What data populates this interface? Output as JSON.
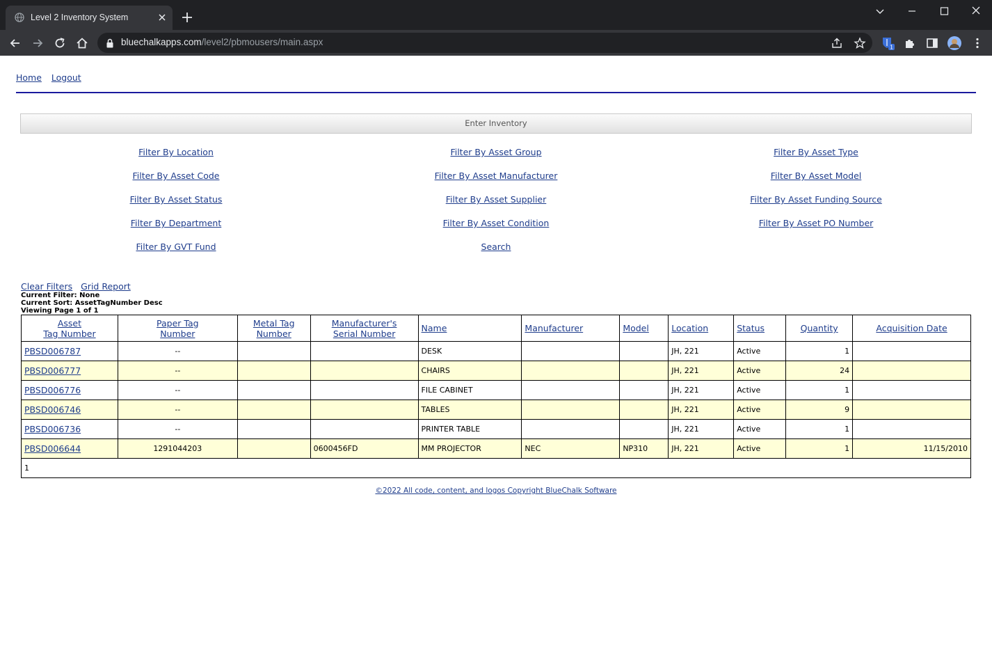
{
  "browser": {
    "tab_title": "Level 2 Inventory System",
    "url_host": "bluechalkapps.com",
    "url_path": "/level2/pbmousers/main.aspx",
    "extension_badge": "1"
  },
  "nav": {
    "home": "Home",
    "logout": "Logout"
  },
  "enter_inventory": "Enter Inventory",
  "filters": [
    [
      "Filter By Location",
      "Filter By Asset Group",
      "Filter By Asset Type"
    ],
    [
      "Filter By Asset Code",
      "Filter By Asset Manufacturer",
      "Filter By Asset Model"
    ],
    [
      "Filter By Asset Status",
      "Filter By Asset Supplier",
      "Filter By Asset Funding Source"
    ],
    [
      "Filter By Department",
      "Filter By Asset Condition",
      "Filter By Asset PO Number"
    ],
    [
      "Filter By GVT Fund",
      "Search",
      ""
    ]
  ],
  "grid_links": {
    "clear": "Clear Filters",
    "report": "Grid Report"
  },
  "status": {
    "filter": "Current Filter: None",
    "sort": "Current Sort: AssetTagNumber Desc",
    "page": "Viewing Page 1 of 1"
  },
  "table": {
    "headers": [
      [
        "Asset",
        "Tag Number"
      ],
      [
        "Paper Tag",
        "Number"
      ],
      [
        "Metal Tag",
        "Number"
      ],
      [
        "Manufacturer's",
        "Serial Number"
      ],
      [
        "Name"
      ],
      [
        "Manufacturer"
      ],
      [
        "Model"
      ],
      [
        "Location"
      ],
      [
        "Status"
      ],
      [
        "Quantity"
      ],
      [
        "Acquisition Date"
      ]
    ],
    "rows": [
      [
        "PBSD006787",
        "--",
        "",
        "",
        "DESK",
        "",
        "",
        "JH, 221",
        "Active",
        "1",
        ""
      ],
      [
        "PBSD006777",
        "--",
        "",
        "",
        "CHAIRS",
        "",
        "",
        "JH, 221",
        "Active",
        "24",
        ""
      ],
      [
        "PBSD006776",
        "--",
        "",
        "",
        "FILE CABINET",
        "",
        "",
        "JH, 221",
        "Active",
        "1",
        ""
      ],
      [
        "PBSD006746",
        "--",
        "",
        "",
        "TABLES",
        "",
        "",
        "JH, 221",
        "Active",
        "9",
        ""
      ],
      [
        "PBSD006736",
        "--",
        "",
        "",
        "PRINTER TABLE",
        "",
        "",
        "JH, 221",
        "Active",
        "1",
        ""
      ],
      [
        "PBSD006644",
        "1291044203",
        "",
        "0600456FD",
        "MM PROJECTOR",
        "NEC",
        "NP310",
        "JH, 221",
        "Active",
        "1",
        "11/15/2010"
      ]
    ],
    "pager": "1"
  },
  "footer": "©2022 All code, content, and logos Copyright BlueChalk Software"
}
